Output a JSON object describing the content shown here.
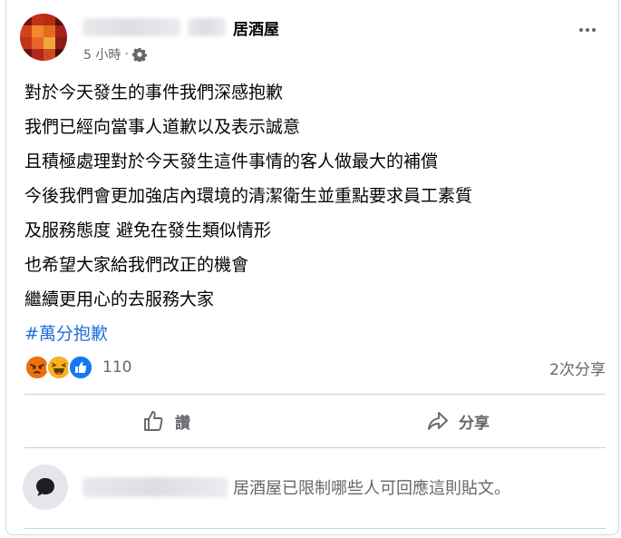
{
  "post": {
    "author_suffix": "居酒屋",
    "time": "5 小時",
    "separator": "·",
    "lines": [
      "對於今天發生的事件我們深感抱歉",
      "我們已經向當事人道歉以及表示誠意",
      "且積極處理對於今天發生這件事情的客人做最大的補償",
      "今後我們會更加強店內環境的清潔衛生並重點要求員工素質",
      "及服務態度 避免在發生類似情形",
      "也希望大家給我們改正的機會",
      "繼續更用心的去服務大家"
    ],
    "hashtag": "#萬分抱歉"
  },
  "reactions": {
    "icons": [
      "angry-reaction-icon",
      "haha-reaction-icon",
      "like-reaction-icon"
    ],
    "count": "110",
    "shares": "2次分享"
  },
  "actions": {
    "like_label": "讚",
    "share_label": "分享"
  },
  "comments": {
    "restriction_text": "居酒屋已限制哪些人可回應這則貼文。"
  },
  "colors": {
    "link": "#216fdb",
    "muted": "#65676b",
    "like_blue": "#1877f2",
    "angry": "#e9710f",
    "haha": "#f7b125"
  }
}
